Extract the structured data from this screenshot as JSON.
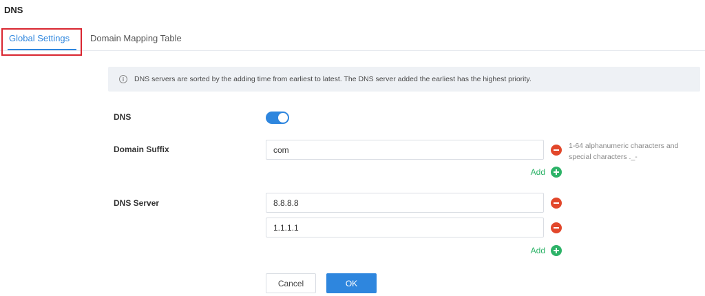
{
  "page": {
    "title": "DNS"
  },
  "tabs": [
    {
      "label": "Global Settings",
      "active": true
    },
    {
      "label": "Domain Mapping Table",
      "active": false
    }
  ],
  "notice": {
    "icon": "info-icon",
    "text": "DNS servers are sorted by the adding time from earliest to latest. The DNS server added the earliest has the highest priority."
  },
  "form": {
    "dns": {
      "label": "DNS",
      "enabled": true
    },
    "domain_suffix": {
      "label": "Domain Suffix",
      "values": [
        "com"
      ],
      "hint": "1-64 alphanumeric characters and special characters ._-",
      "add_label": "Add"
    },
    "dns_server": {
      "label": "DNS Server",
      "values": [
        "8.8.8.8",
        "1.1.1.1"
      ],
      "add_label": "Add"
    }
  },
  "buttons": {
    "cancel": "Cancel",
    "ok": "OK"
  },
  "colors": {
    "accent": "#2e86de",
    "remove": "#e2472b",
    "add": "#2db368",
    "highlight": "#d9252f"
  }
}
